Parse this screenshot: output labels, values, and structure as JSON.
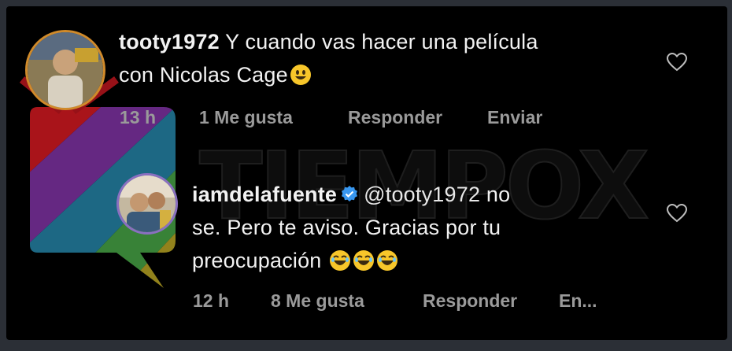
{
  "comments": [
    {
      "username": "tooty1972",
      "text_line1": "Y cuando vas hacer una película",
      "text_line2": "con Nicolas Cage",
      "time": "13 h",
      "likes": "1 Me gusta",
      "reply": "Responder",
      "send": "Enviar"
    },
    {
      "username": "iamdelafuente",
      "mention": "@tooty1972",
      "text_line1_rest": "no",
      "text_line2": "se. Pero te aviso. Gracias por tu",
      "text_line3": "preocupación",
      "time": "12 h",
      "likes": "8 Me gusta",
      "reply": "Responder",
      "send": "En..."
    }
  ],
  "watermark": {
    "text": "TIEMPOX"
  },
  "icons": {
    "emoji": "grinning-face-icon",
    "laugh": "laughing-face-icon",
    "verified": "verified-badge-icon",
    "like": "heart-outline-icon"
  },
  "colors": {
    "background": "#000000",
    "text": "#f2f2f2",
    "meta": "#9a9a9a",
    "verified": "#3897f0"
  }
}
